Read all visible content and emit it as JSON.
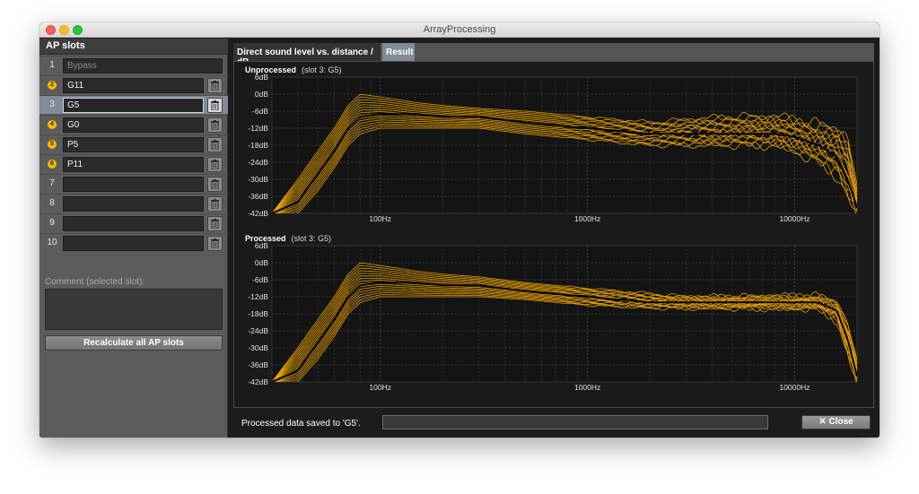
{
  "window": {
    "title": "ArrayProcessing"
  },
  "sidebar": {
    "header": "AP slots",
    "slots": [
      {
        "num": "1",
        "name": "Bypass",
        "badge": false,
        "delete": false
      },
      {
        "num": "2",
        "name": "G11",
        "badge": true,
        "delete": true
      },
      {
        "num": "3",
        "name": "G5",
        "badge": false,
        "delete": true,
        "selected": true
      },
      {
        "num": "4",
        "name": "G0",
        "badge": true,
        "delete": true
      },
      {
        "num": "5",
        "name": "P5",
        "badge": true,
        "delete": true
      },
      {
        "num": "6",
        "name": "P11",
        "badge": true,
        "delete": true
      },
      {
        "num": "7",
        "name": "",
        "badge": false,
        "delete": true
      },
      {
        "num": "8",
        "name": "",
        "badge": false,
        "delete": true
      },
      {
        "num": "9",
        "name": "",
        "badge": false,
        "delete": true
      },
      {
        "num": "10",
        "name": "",
        "badge": false,
        "delete": true
      }
    ],
    "comment_label": "Comment (selected slot):",
    "comment_value": "",
    "recalc_label": "Recalculate all AP slots"
  },
  "tabs": [
    {
      "label": "Direct sound level vs. distance / dB",
      "active": false
    },
    {
      "label": "Result",
      "active": true
    }
  ],
  "plots": [
    {
      "title": "Unprocessed",
      "subtitle": "(slot 3: G5)"
    },
    {
      "title": "Processed",
      "subtitle": "(slot 3: G5)"
    }
  ],
  "chart_data": [
    {
      "type": "line",
      "title": "Unprocessed",
      "subtitle": "(slot 3: G5)",
      "x_scale": "log",
      "xlim": [
        30,
        20000
      ],
      "ylim": [
        -42,
        6
      ],
      "yticks": [
        "6dB",
        "0dB",
        "-6dB",
        "-12dB",
        "-18dB",
        "-24dB",
        "-30dB",
        "-36dB",
        "-42dB"
      ],
      "xticks": [
        "100Hz",
        "1000Hz",
        "10000Hz"
      ],
      "grid": true,
      "series_color": "#f5a800",
      "highlight_color": "#000000",
      "envelope": {
        "x": [
          30,
          40,
          50,
          60,
          70,
          80,
          100,
          150,
          200,
          300,
          500,
          1000,
          2000,
          3000,
          5000,
          8000,
          10000,
          13000,
          16000,
          18000,
          20000
        ],
        "upper": [
          -42,
          -30,
          -20,
          -12,
          -4,
          0,
          -1,
          -3,
          -4,
          -5,
          -6,
          -8,
          -10,
          -9,
          -8,
          -8,
          -9,
          -11,
          -12,
          -16,
          -34
        ],
        "lower": [
          -42,
          -42,
          -34,
          -26,
          -18,
          -14,
          -12,
          -12,
          -12,
          -12,
          -14,
          -16,
          -18,
          -18,
          -18,
          -18,
          -20,
          -24,
          -28,
          -36,
          -42
        ],
        "highlight": [
          -42,
          -38,
          -28,
          -20,
          -12,
          -8,
          -7,
          -7,
          -8,
          -8,
          -10,
          -12,
          -14,
          -14,
          -14,
          -14,
          -15,
          -18,
          -22,
          -30,
          -40
        ]
      }
    },
    {
      "type": "line",
      "title": "Processed",
      "subtitle": "(slot 3: G5)",
      "x_scale": "log",
      "xlim": [
        30,
        20000
      ],
      "ylim": [
        -42,
        6
      ],
      "yticks": [
        "6dB",
        "0dB",
        "-6dB",
        "-12dB",
        "-18dB",
        "-24dB",
        "-30dB",
        "-36dB",
        "-42dB"
      ],
      "xticks": [
        "100Hz",
        "1000Hz",
        "10000Hz"
      ],
      "grid": true,
      "series_color": "#f5a800",
      "highlight_color": "#000000",
      "envelope": {
        "x": [
          30,
          40,
          50,
          60,
          70,
          80,
          100,
          150,
          200,
          300,
          500,
          1000,
          2000,
          3000,
          5000,
          8000,
          10000,
          13000,
          16000,
          18000,
          20000
        ],
        "upper": [
          -42,
          -30,
          -20,
          -12,
          -4,
          0,
          -1,
          -3,
          -4,
          -5,
          -7,
          -9,
          -11,
          -12,
          -12,
          -12,
          -12,
          -12,
          -14,
          -22,
          -36
        ],
        "lower": [
          -42,
          -42,
          -34,
          -26,
          -18,
          -14,
          -12,
          -12,
          -12,
          -12,
          -13,
          -15,
          -16,
          -16,
          -16,
          -16,
          -16,
          -16,
          -20,
          -32,
          -42
        ],
        "highlight": [
          -42,
          -38,
          -28,
          -20,
          -12,
          -8,
          -7,
          -7,
          -8,
          -8,
          -10,
          -12,
          -14,
          -14,
          -14,
          -14,
          -14,
          -14,
          -17,
          -27,
          -40
        ]
      }
    }
  ],
  "footer": {
    "status": "Processed data saved to 'G5'.",
    "progress": 0,
    "close_label": "Close"
  }
}
